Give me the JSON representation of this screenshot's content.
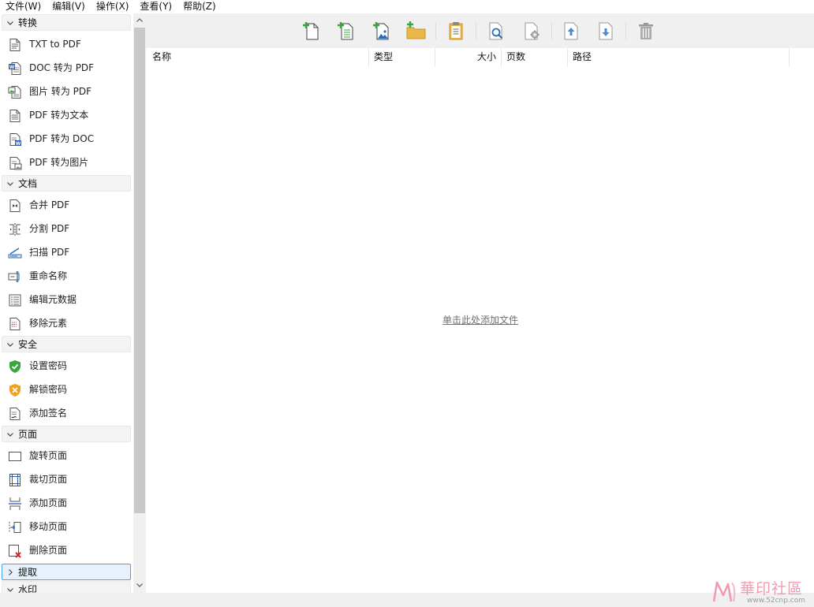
{
  "menubar": [
    {
      "label": "文件(W)"
    },
    {
      "label": "编辑(V)"
    },
    {
      "label": "操作(X)"
    },
    {
      "label": "查看(Y)"
    },
    {
      "label": "帮助(Z)"
    }
  ],
  "sidebar": {
    "sections": [
      {
        "title": "转换",
        "expanded": true,
        "items": [
          {
            "label": "TXT to PDF",
            "icon": "txt-file-icon"
          },
          {
            "label": "DOC 转为 PDF",
            "icon": "word-file-icon"
          },
          {
            "label": "图片 转为 PDF",
            "icon": "image-file-icon"
          },
          {
            "label": "PDF 转为文本",
            "icon": "text-file-icon"
          },
          {
            "label": "PDF 转为 DOC",
            "icon": "pdf-to-doc-icon"
          },
          {
            "label": "PDF 转为图片",
            "icon": "pdf-to-image-icon"
          }
        ]
      },
      {
        "title": "文档",
        "expanded": true,
        "items": [
          {
            "label": "合并 PDF",
            "icon": "merge-icon"
          },
          {
            "label": "分割 PDF",
            "icon": "split-icon"
          },
          {
            "label": "扫描 PDF",
            "icon": "scanner-icon"
          },
          {
            "label": "重命名称",
            "icon": "rename-icon"
          },
          {
            "label": "编辑元数据",
            "icon": "metadata-icon"
          },
          {
            "label": "移除元素",
            "icon": "remove-elements-icon"
          }
        ]
      },
      {
        "title": "安全",
        "expanded": true,
        "items": [
          {
            "label": "设置密码",
            "icon": "shield-check-icon"
          },
          {
            "label": "解锁密码",
            "icon": "shield-x-icon"
          },
          {
            "label": "添加签名",
            "icon": "signature-icon"
          }
        ]
      },
      {
        "title": "页面",
        "expanded": true,
        "items": [
          {
            "label": "旋转页面",
            "icon": "rotate-page-icon"
          },
          {
            "label": "裁切页面",
            "icon": "crop-page-icon"
          },
          {
            "label": "添加页面",
            "icon": "add-page-icon"
          },
          {
            "label": "移动页面",
            "icon": "move-page-icon"
          },
          {
            "label": "删除页面",
            "icon": "delete-page-icon"
          }
        ]
      },
      {
        "title": "提取",
        "expanded": false,
        "selected": true,
        "items": []
      },
      {
        "title": "水印",
        "expanded": true,
        "items": []
      }
    ]
  },
  "toolbar": [
    {
      "name": "add-file-button",
      "icon": "add-file-icon"
    },
    {
      "name": "add-text-file-button",
      "icon": "add-text-file-icon"
    },
    {
      "name": "add-image-file-button",
      "icon": "add-image-file-icon"
    },
    {
      "name": "add-folder-button",
      "icon": "add-folder-icon"
    },
    {
      "name": "paste-button",
      "icon": "clipboard-icon"
    },
    {
      "name": "preview-button",
      "icon": "magnifier-document-icon"
    },
    {
      "name": "settings-button",
      "icon": "document-gear-icon"
    },
    {
      "name": "move-up-button",
      "icon": "arrow-up-icon"
    },
    {
      "name": "move-down-button",
      "icon": "arrow-down-icon"
    },
    {
      "name": "delete-button",
      "icon": "trash-icon"
    }
  ],
  "file_list": {
    "columns": [
      "名称",
      "类型",
      "大小",
      "页数",
      "路径"
    ],
    "rows": [],
    "empty_text": "单击此处添加文件"
  },
  "watermark": {
    "text": "華印社區",
    "url": "www.52cnp.com"
  },
  "colors": {
    "accent_green": "#3aa640",
    "folder": "#e8b84a",
    "shield_green": "#3aa640",
    "shield_orange": "#f0a020",
    "delete_red": "#e02020",
    "selection_border": "#4c9fe8"
  }
}
